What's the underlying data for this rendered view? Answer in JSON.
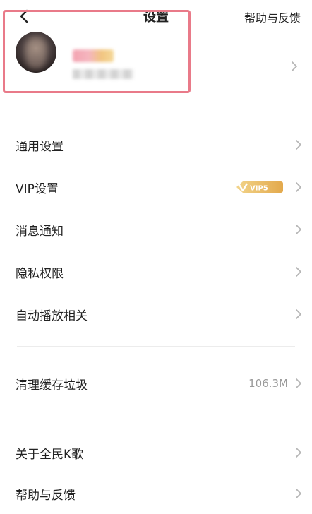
{
  "header": {
    "title": "设置",
    "help_label": "帮助与反馈"
  },
  "settings": {
    "general": "通用设置",
    "vip": "VIP设置",
    "vip_badge": "VIP5",
    "notifications": "消息通知",
    "privacy": "隐私权限",
    "autoplay": "自动播放相关",
    "clear_cache": "清理缓存垃圾",
    "cache_size": "106.3M",
    "about": "关于全民K歌",
    "help": "帮助与反馈"
  },
  "colors": {
    "highlight_border": "#e97a89",
    "vip_gold": "#e8b85a"
  }
}
